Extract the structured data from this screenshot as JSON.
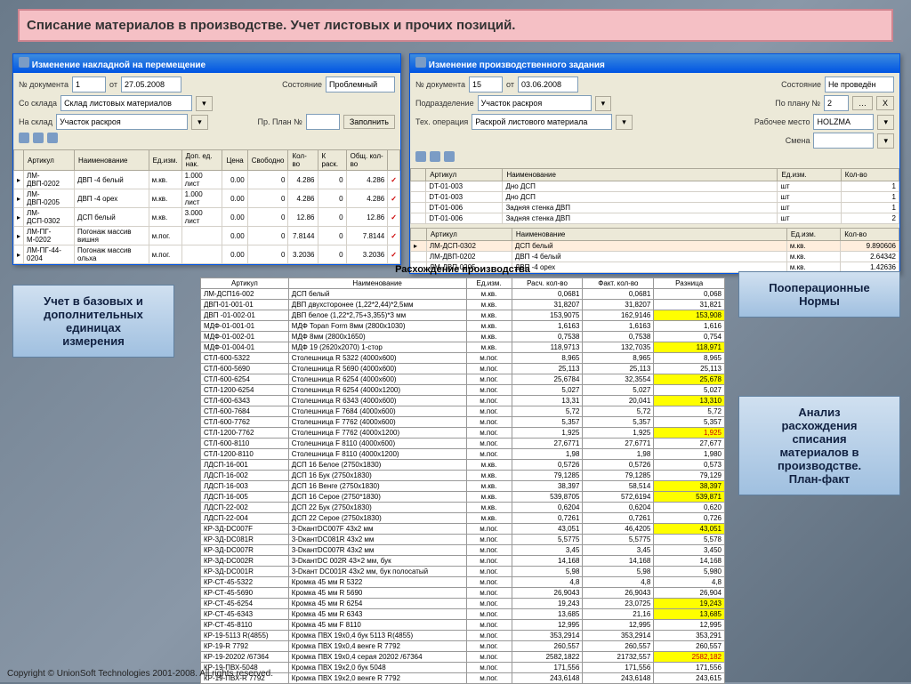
{
  "title": "Списание материалов в производстве. Учет листовых и прочих позиций.",
  "footer": "Copyright © UnionSoft Technologies 2001-2008. All rights reserved.",
  "win1": {
    "title": "Изменение накладной на перемещение",
    "doc_label": "№ документа",
    "doc_no": "1",
    "date_label": "от",
    "date": "27.05.2008",
    "state_label": "Состояние",
    "state": "Проблемный",
    "from_label": "Со склада",
    "from": "Склад листовых материалов",
    "to_label": "На склад",
    "to": "Участок раскроя",
    "plan_label": "Пр. План №",
    "plan": "",
    "fill_btn": "Заполнить",
    "headers": {
      "art": "Артикул",
      "name": "Наименование",
      "edizm": "Ед.изм.",
      "dop": "Доп. ед.\nнак.",
      "price": "Цена",
      "free": "Свободно",
      "qty": "Кол-во",
      "krask": "К раск.",
      "total": "Общ. кол-во"
    },
    "rows": [
      {
        "art": "ЛМ-ДВП-0202",
        "name": "ДВП -4 белый",
        "edizm": "м.кв.",
        "dop": "1.000 лист",
        "price": "0.00",
        "free": "0",
        "qty": "4.286",
        "k": "0",
        "total": "4.286"
      },
      {
        "art": "ЛМ-ДВП-0205",
        "name": "ДВП -4 орех",
        "edizm": "м.кв.",
        "dop": "1.000 лист",
        "price": "0.00",
        "free": "0",
        "qty": "4.286",
        "k": "0",
        "total": "4.286"
      },
      {
        "art": "ЛМ-ДСП-0302",
        "name": "ДСП белый",
        "edizm": "м.кв.",
        "dop": "3.000 лист",
        "price": "0.00",
        "free": "0",
        "qty": "12.86",
        "k": "0",
        "total": "12.86"
      },
      {
        "art": "ЛМ-ПГ-М-0202",
        "name": "Погонаж массив вишня",
        "edizm": "м.пог.",
        "dop": "",
        "price": "0.00",
        "free": "0",
        "qty": "7.8144",
        "k": "0",
        "total": "7.8144"
      },
      {
        "art": "ЛМ-ПГ-44-0204",
        "name": "Погонаж массив ольха",
        "edizm": "м.пог.",
        "dop": "",
        "price": "0.00",
        "free": "0",
        "qty": "3.2036",
        "k": "0",
        "total": "3.2036"
      }
    ]
  },
  "win2": {
    "title": "Изменение производственного задания",
    "doc_label": "№ документа",
    "doc_no": "15",
    "date_label": "от",
    "date": "03.06.2008",
    "state_label": "Состояние",
    "state": "Не проведён",
    "dep_label": "Подразделение",
    "dep": "Участок раскроя",
    "plan_label": "По плану №",
    "plan_no": "2",
    "x": "X",
    "op_label": "Тех. операция",
    "op": "Раскрой листового материала",
    "work_label": "Рабочее место",
    "work": "HOLZMA",
    "shift_label": "Смена",
    "headers": {
      "art": "Артикул",
      "name": "Наименование",
      "edizm": "Ед.изм.",
      "qty": "Кол-во"
    },
    "top_rows": [
      {
        "art": "DT-01-003",
        "name": "Дно ДСП",
        "edizm": "шт",
        "qty": "1"
      },
      {
        "art": "DT-01-003",
        "name": "Дно ДСП",
        "edizm": "шт",
        "qty": "1"
      },
      {
        "art": "DT-01-006",
        "name": "Задняя стенка ДВП",
        "edizm": "шт",
        "qty": "1"
      },
      {
        "art": "DT-01-006",
        "name": "Задняя стенка ДВП",
        "edizm": "шт",
        "qty": "2"
      }
    ],
    "bot_rows": [
      {
        "art": "ЛМ-ДСП-0302",
        "name": "ДСП белый",
        "edizm": "м.кв.",
        "qty": "9.890606"
      },
      {
        "art": "ЛМ-ДВП-0202",
        "name": "ДВП -4 белый",
        "edizm": "м.кв.",
        "qty": "2.64342"
      },
      {
        "art": "ЛМ-ДВП-0205",
        "name": "ДВП -4 орех",
        "edizm": "м.кв.",
        "qty": "1.42636"
      }
    ]
  },
  "callouts": {
    "left": "Учет в базовых и\nдополнительных\nединицах\nизмерения",
    "right1": "Пооперационные\nНормы",
    "right2": "Анализ\nрасхождения\nсписания\nматериалов в\nпроизводстве.\nПлан-факт"
  },
  "discr": {
    "title": "Расхождение производства",
    "headers": {
      "art": "Артикул",
      "name": "Наименование",
      "edizm": "Ед.изм.",
      "rasch": "Расч. кол-во",
      "fakt": "Факт. кол-во",
      "diff": "Разница"
    },
    "rows": [
      {
        "art": "ЛМ-ДСП16-002",
        "name": "ДСП белый",
        "edizm": "м.кв.",
        "r": "0,0681",
        "f": "0,0681",
        "d": "0,068",
        "hl": 0
      },
      {
        "art": "ДВП-01-001-01",
        "name": "ДВП двухсторонее (1,22*2,44)*2,5мм",
        "edizm": "м.кв.",
        "r": "31,8207",
        "f": "31,8207",
        "d": "31,821",
        "hl": 0
      },
      {
        "art": "ДВП -01-002-01",
        "name": "ДВП белое (1,22*2,75+3,355)*3 мм",
        "edizm": "м.кв.",
        "r": "153,9075",
        "f": "162,9146",
        "d": "153,908",
        "hl": 1
      },
      {
        "art": "МДФ-01-001-01",
        "name": "МДФ Topan Form 8мм (2800х1030)",
        "edizm": "м.кв.",
        "r": "1,6163",
        "f": "1,6163",
        "d": "1,616",
        "hl": 0
      },
      {
        "art": "МДФ-01-002-01",
        "name": "МДФ  8мм (2800х1650)",
        "edizm": "м.кв.",
        "r": "0,7538",
        "f": "0,7538",
        "d": "0,754",
        "hl": 0
      },
      {
        "art": "МДФ-01-004-01",
        "name": "МДФ 19 (2620х2070) 1-стор",
        "edizm": "м.кв.",
        "r": "118,9713",
        "f": "132,7035",
        "d": "118,971",
        "hl": 1
      },
      {
        "art": "СТЛ-600-5322",
        "name": "Столешница R 5322 (4000х600)",
        "edizm": "м.пог.",
        "r": "8,965",
        "f": "8,965",
        "d": "8,965",
        "hl": 0
      },
      {
        "art": "СТЛ-600-5690",
        "name": "Столешница R 5690 (4000х600)",
        "edizm": "м.пог.",
        "r": "25,113",
        "f": "25,113",
        "d": "25,113",
        "hl": 0
      },
      {
        "art": "СТЛ-600-6254",
        "name": "Столешница R 6254 (4000х600)",
        "edizm": "м.пог.",
        "r": "25,6784",
        "f": "32,3554",
        "d": "25,678",
        "hl": 1
      },
      {
        "art": "СТЛ-1200-6254",
        "name": "Столешница R 6254 (4000х1200)",
        "edizm": "м.пог.",
        "r": "5,027",
        "f": "5,027",
        "d": "5,027",
        "hl": 0
      },
      {
        "art": "СТЛ-600-6343",
        "name": "Столешница R 6343 (4000х600)",
        "edizm": "м.пог.",
        "r": "13,31",
        "f": "20,041",
        "d": "13,310",
        "hl": 1
      },
      {
        "art": "СТЛ-600-7684",
        "name": "Столешница F 7684 (4000х600)",
        "edizm": "м.пог.",
        "r": "5,72",
        "f": "5,72",
        "d": "5,72",
        "hl": 0
      },
      {
        "art": "СТЛ-600-7762",
        "name": "Столешница F 7762 (4000х600)",
        "edizm": "м.пог.",
        "r": "5,357",
        "f": "5,357",
        "d": "5,357",
        "hl": 0
      },
      {
        "art": "СТЛ-1200-7762",
        "name": "Столешница F 7762 (4000х1200)",
        "edizm": "м.пог.",
        "r": "1,925",
        "f": "1,925",
        "d": "1,925",
        "hl": 1,
        "red": 1
      },
      {
        "art": "СТЛ-600-8110",
        "name": "Столешница F 8110 (4000х600)",
        "edizm": "м.пог.",
        "r": "27,6771",
        "f": "27,6771",
        "d": "27,677",
        "hl": 0
      },
      {
        "art": "СТЛ-1200-8110",
        "name": "Столешница F 8110 (4000х1200)",
        "edizm": "м.пог.",
        "r": "1,98",
        "f": "1,98",
        "d": "1,980",
        "hl": 0
      },
      {
        "art": "ЛДСП-16-001",
        "name": "ДСП 16 Белое (2750х1830)",
        "edizm": "м.кв.",
        "r": "0,5726",
        "f": "0,5726",
        "d": "0,573",
        "hl": 0
      },
      {
        "art": "ЛДСП-16-002",
        "name": "ДСП 16 Бук (2750х1830)",
        "edizm": "м.кв.",
        "r": "79,1285",
        "f": "79,1285",
        "d": "79,129",
        "hl": 0
      },
      {
        "art": "ЛДСП-16-003",
        "name": "ДСП 16 Венге (2750х1830)",
        "edizm": "м.кв.",
        "r": "38,397",
        "f": "58,514",
        "d": "38,397",
        "hl": 1
      },
      {
        "art": "ЛДСП-16-005",
        "name": "ДСП 16 Серое (2750*1830)",
        "edizm": "м.кв.",
        "r": "539,8705",
        "f": "572,6194",
        "d": "539,871",
        "hl": 1
      },
      {
        "art": "ЛДСП-22-002",
        "name": "ДСП 22 Бук (2750х1830)",
        "edizm": "м.кв.",
        "r": "0,6204",
        "f": "0,6204",
        "d": "0,620",
        "hl": 0
      },
      {
        "art": "ЛДСП-22-004",
        "name": "ДСП 22 Серое (2750х1830)",
        "edizm": "м.кв.",
        "r": "0,7261",
        "f": "0,7261",
        "d": "0,726",
        "hl": 0
      },
      {
        "art": "КР-3Д-DC007F",
        "name": "3-DкантDC007F 43х2 мм",
        "edizm": "м.пог.",
        "r": "43,051",
        "f": "46,4205",
        "d": "43,051",
        "hl": 1
      },
      {
        "art": "КР-3Д-DC081R",
        "name": "3-DкантDC081R 43х2 мм",
        "edizm": "м.пог.",
        "r": "5,5775",
        "f": "5,5775",
        "d": "5,578",
        "hl": 0
      },
      {
        "art": "КР-3Д-DC007R",
        "name": "3-DкантDC007R 43х2 мм",
        "edizm": "м.пог.",
        "r": "3,45",
        "f": "3,45",
        "d": "3,450",
        "hl": 0
      },
      {
        "art": "КР-3Д-DC002R",
        "name": "3-DкантDC 002R 43×2 мм, бук",
        "edizm": "м.пог.",
        "r": "14,168",
        "f": "14,168",
        "d": "14,168",
        "hl": 0
      },
      {
        "art": "КР-3Д-DC001R",
        "name": "3-Dкант DC001R 43х2 мм, бук полосатый",
        "edizm": "м.пог.",
        "r": "5,98",
        "f": "5,98",
        "d": "5,980",
        "hl": 0
      },
      {
        "art": "КР-СТ-45-5322",
        "name": "Кромка 45 мм R 5322",
        "edizm": "м.пог.",
        "r": "4,8",
        "f": "4,8",
        "d": "4,8",
        "hl": 0
      },
      {
        "art": "КР-СТ-45-5690",
        "name": "Кромка 45 мм R 5690",
        "edizm": "м.пог.",
        "r": "26,9043",
        "f": "26,9043",
        "d": "26,904",
        "hl": 0
      },
      {
        "art": "КР-СТ-45-6254",
        "name": "Кромка 45 мм R 6254",
        "edizm": "м.пог.",
        "r": "19,243",
        "f": "23,0725",
        "d": "19,243",
        "hl": 1
      },
      {
        "art": "КР-СТ-45-6343",
        "name": "Кромка 45 мм R 6343",
        "edizm": "м.пог.",
        "r": "13,685",
        "f": "21,16",
        "d": "13,685",
        "hl": 1
      },
      {
        "art": "КР-СТ-45-8110",
        "name": "Кромка 45 мм F 8110",
        "edizm": "м.пог.",
        "r": "12,995",
        "f": "12,995",
        "d": "12,995",
        "hl": 0
      },
      {
        "art": "КР-19-5113 R(4855)",
        "name": "Кромка ПВХ 19х0,4 бук 5113 R(4855)",
        "edizm": "м.пог.",
        "r": "353,2914",
        "f": "353,2914",
        "d": "353,291",
        "hl": 0
      },
      {
        "art": "КР-19-R 7792",
        "name": "Кромка ПВХ 19х0,4 венге R 7792",
        "edizm": "м.пог.",
        "r": "260,557",
        "f": "260,557",
        "d": "260,557",
        "hl": 0
      },
      {
        "art": "КР-19-20202 /67364",
        "name": "Кромка ПВХ 19х0,4  серая  20202 /67364",
        "edizm": "м.пог.",
        "r": "2582,1822",
        "f": "21732,557",
        "d": "2582,182",
        "hl": 1,
        "red": 1
      },
      {
        "art": "КР-19-ПВХ-5048",
        "name": "Кромка ПВХ 19х2,0 бук 5048",
        "edizm": "м.пог.",
        "r": "171,556",
        "f": "171,556",
        "d": "171,556",
        "hl": 0
      },
      {
        "art": "КР-19-ПВХ-R 7792",
        "name": "Кромка ПВХ 19х2,0 венге R 7792",
        "edizm": "м.пог.",
        "r": "243,6148",
        "f": "243,6148",
        "d": "243,615",
        "hl": 0
      }
    ]
  }
}
